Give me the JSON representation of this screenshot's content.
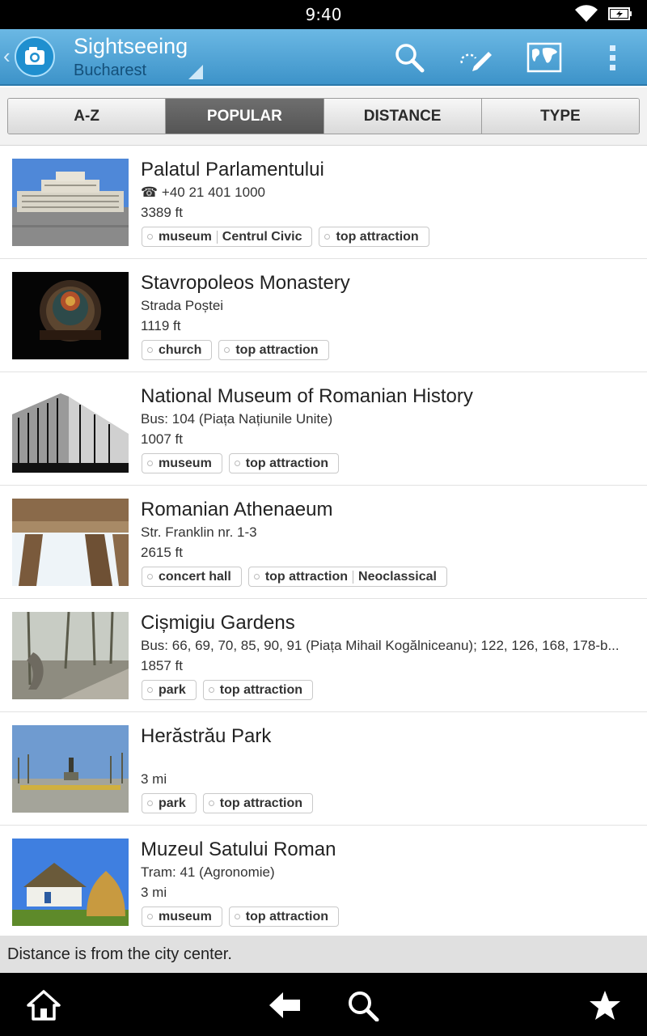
{
  "status_bar": {
    "time": "9:40"
  },
  "action_bar": {
    "title": "Sightseeing",
    "subtitle": "Bucharest",
    "icons": [
      "camera-logo-icon",
      "search-icon",
      "route-edit-icon",
      "world-map-icon",
      "overflow-menu-icon"
    ]
  },
  "tabs": [
    {
      "label": "A-Z",
      "active": false
    },
    {
      "label": "POPULAR",
      "active": true
    },
    {
      "label": "DISTANCE",
      "active": false
    },
    {
      "label": "TYPE",
      "active": false
    }
  ],
  "places": [
    {
      "title": "Palatul Parlamentului",
      "detail": "☎ +40 21 401 1000",
      "distance": "3389 ft",
      "tags": [
        [
          "museum",
          "Centrul Civic"
        ],
        [
          "top attraction"
        ]
      ]
    },
    {
      "title": "Stavropoleos Monastery",
      "detail": "Strada Poștei",
      "distance": "1119 ft",
      "tags": [
        [
          "church"
        ],
        [
          "top attraction"
        ]
      ]
    },
    {
      "title": "National Museum of Romanian History",
      "detail": "Bus: 104 (Piața Națiunile Unite)",
      "distance": "1007 ft",
      "tags": [
        [
          "museum"
        ],
        [
          "top attraction"
        ]
      ]
    },
    {
      "title": "Romanian Athenaeum",
      "detail": "Str. Franklin nr. 1-3",
      "distance": "2615 ft",
      "tags": [
        [
          "concert hall"
        ],
        [
          "top attraction",
          "Neoclassical"
        ]
      ]
    },
    {
      "title": "Cișmigiu Gardens",
      "detail": "Bus: 66, 69, 70, 85, 90, 91 (Piața Mihail Kogălniceanu); 122, 126, 168, 178-b...",
      "distance": "1857 ft",
      "tags": [
        [
          "park"
        ],
        [
          "top attraction"
        ]
      ]
    },
    {
      "title": "Herăstrău Park",
      "detail": "",
      "distance": "3 mi",
      "tags": [
        [
          "park"
        ],
        [
          "top attraction"
        ]
      ]
    },
    {
      "title": "Muzeul Satului Roman",
      "detail": "Tram: 41 (Agronomie)",
      "distance": "3 mi",
      "tags": [
        [
          "museum"
        ],
        [
          "top attraction"
        ]
      ]
    }
  ],
  "footer_note": "Distance is from the city center.",
  "nav_bar": {
    "icons": [
      "home-icon",
      "back-icon",
      "search-icon",
      "star-icon"
    ]
  },
  "colors": {
    "action_bar": "#4fa3d6",
    "active_tab": "#5f5f5f"
  }
}
